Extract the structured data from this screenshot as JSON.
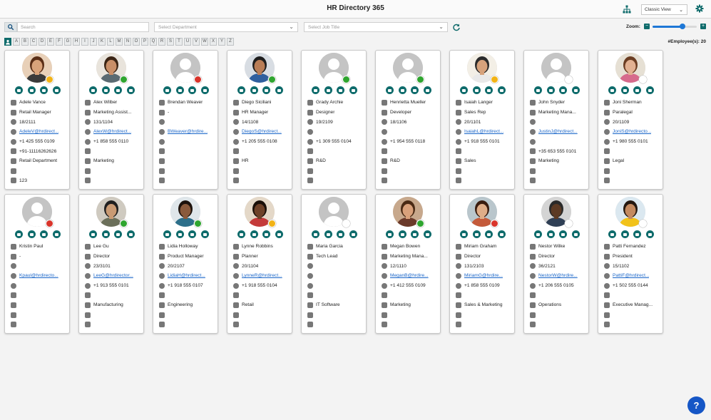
{
  "header": {
    "title": "HR Directory 365",
    "view": "Classic View"
  },
  "toolbar": {
    "search_placeholder": "Search",
    "department_placeholder": "Select Department",
    "job_placeholder": "Select Job Title",
    "zoom_label": "Zoom:",
    "zoom_level": 0.68,
    "employee_count": "#Employee(s): 20"
  },
  "alphabet": [
    "A",
    "B",
    "C",
    "D",
    "E",
    "F",
    "G",
    "H",
    "I",
    "J",
    "K",
    "L",
    "M",
    "N",
    "O",
    "P",
    "Q",
    "R",
    "S",
    "T",
    "U",
    "V",
    "W",
    "X",
    "Y",
    "Z"
  ],
  "colors": {
    "accent": "#0e6b6b",
    "link": "#1a66c9",
    "available": "#2fa52f",
    "busy": "#d9342b",
    "away": "#f2b316",
    "offline": "#ffffff",
    "help": "#1556c6"
  },
  "employees": [
    {
      "name": "Adele Vance",
      "title": "Retail Manager",
      "office": "18/2111",
      "email": "AdeleV@hrdirect...",
      "phone": "+1 425 555 0109",
      "mobile": "+91-11116262626",
      "department": "Retail Department",
      "extra": "",
      "extra2": "123",
      "status": "away",
      "photo": true,
      "skin": "#d9a37a",
      "hair": "#5a2e16",
      "shirt": "#3a3a3a",
      "bg": "#e8d0b8"
    },
    {
      "name": "Alex Wilber",
      "title": "Marketing Assist...",
      "office": "131/1104",
      "email": "AlexW@hrdirect...",
      "phone": "+1 858 555 0110",
      "mobile": "",
      "department": "Marketing",
      "extra": "",
      "extra2": "",
      "status": "available",
      "photo": true,
      "skin": "#c98f68",
      "hair": "#3b2414",
      "shirt": "#5a6a72",
      "bg": "#e9e4dc"
    },
    {
      "name": "Brendan Weaver",
      "title": "-",
      "office": "",
      "email": "BWeaver@hrdire...",
      "phone": "",
      "mobile": "",
      "department": "",
      "extra": "",
      "extra2": "",
      "status": "busy",
      "photo": false
    },
    {
      "name": "Diego Siciliani",
      "title": "HR Manager",
      "office": "14/1108",
      "email": "DiegoS@hrdirect...",
      "phone": "+1 205 555 0108",
      "mobile": "",
      "department": "HR",
      "extra": "",
      "extra2": "",
      "status": "available",
      "photo": true,
      "skin": "#b97d56",
      "hair": "#1e1e1e",
      "shirt": "#2f5f9e",
      "bg": "#d8dde3"
    },
    {
      "name": "Grady Archie",
      "title": "Designer",
      "office": "19/2109",
      "email": "",
      "phone": "+1 309 555 0104",
      "mobile": "",
      "department": "R&D",
      "extra": "",
      "extra2": "",
      "status": "available",
      "photo": false
    },
    {
      "name": "Henrietta Mueller",
      "title": "Developer",
      "office": "18/1106",
      "email": "",
      "phone": "+1 954 555 0118",
      "mobile": "",
      "department": "R&D",
      "extra": "",
      "extra2": "",
      "status": "available",
      "photo": false
    },
    {
      "name": "Isaiah Langer",
      "title": "Sales Rep",
      "office": "20/1101",
      "email": "IsaiahL@hrdirect...",
      "phone": "+1 918 555 0101",
      "mobile": "",
      "department": "Sales",
      "extra": "",
      "extra2": "",
      "status": "away",
      "photo": true,
      "skin": "#d6a27c",
      "hair": "#2b2b2b",
      "shirt": "#e9e9e9",
      "bg": "#f3efe6"
    },
    {
      "name": "John Snyder",
      "title": "Marketing Mana...",
      "office": "",
      "email": "JustinJ@hrdirect...",
      "phone": "",
      "mobile": "+35 653 555 0101",
      "department": "Marketing",
      "extra": "",
      "extra2": "",
      "status": "offline",
      "photo": false
    },
    {
      "name": "Joni Sherman",
      "title": "Paralegal",
      "office": "20/1109",
      "email": "JoniS@hrdirecto...",
      "phone": "+1 980 555 0101",
      "mobile": "",
      "department": "Legal",
      "extra": "",
      "extra2": "",
      "status": "offline",
      "photo": true,
      "skin": "#e2b192",
      "hair": "#6b3d22",
      "shirt": "#d66a8c",
      "bg": "#e6e0d4"
    },
    {
      "name": "Kristin Paul",
      "title": "-",
      "office": "",
      "email": "Kpaul@hrdirecto...",
      "phone": "",
      "mobile": "",
      "department": "",
      "extra": "",
      "extra2": "",
      "status": "busy",
      "photo": false
    },
    {
      "name": "Lee Gu",
      "title": "Director",
      "office": "23/3101",
      "email": "LeeG@hrdirector...",
      "phone": "+1 913 555 0101",
      "mobile": "",
      "department": "Manufacturing",
      "extra": "",
      "extra2": "",
      "status": "available",
      "photo": true,
      "skin": "#c99a73",
      "hair": "#1f1f1f",
      "shirt": "#6b6f5a",
      "bg": "#cfcac0"
    },
    {
      "name": "Lidia Holloway",
      "title": "Product Manager",
      "office": "20/2107",
      "email": "LidiaH@hrdirect...",
      "phone": "+1 918 555 0107",
      "mobile": "",
      "department": "Engineering",
      "extra": "",
      "extra2": "",
      "status": "available",
      "photo": true,
      "skin": "#8a5a3c",
      "hair": "#1c120c",
      "shirt": "#2c6f8a",
      "bg": "#dfe6ea"
    },
    {
      "name": "Lynne Robbins",
      "title": "Planner",
      "office": "20/1104",
      "email": "LynneR@hrdirect...",
      "phone": "+1 918 555 0104",
      "mobile": "",
      "department": "Retail",
      "extra": "",
      "extra2": "",
      "status": "away",
      "photo": true,
      "skin": "#6e4128",
      "hair": "#1a0f08",
      "shirt": "#c43a3a",
      "bg": "#e4d8c8"
    },
    {
      "name": "Maria Garcia",
      "title": "Tech Lead",
      "office": "",
      "email": "",
      "phone": "",
      "mobile": "",
      "department": "IT Software",
      "extra": "",
      "extra2": "",
      "status": "offline",
      "photo": false
    },
    {
      "name": "Megan Bowen",
      "title": "Marketing Mana...",
      "office": "12/1110",
      "email": "MeganB@hrdire...",
      "phone": "+1 412 555 0109",
      "mobile": "",
      "department": "Marketing",
      "extra": "",
      "extra2": "",
      "status": "available",
      "photo": true,
      "skin": "#d9a17b",
      "hair": "#4a2a14",
      "shirt": "#6b3a2a",
      "bg": "#c7a88c"
    },
    {
      "name": "Miriam Graham",
      "title": "Director",
      "office": "131/2103",
      "email": "MiriamG@hrdire...",
      "phone": "+1 858 555 0109",
      "mobile": "",
      "department": "Sales & Marketing",
      "extra": "",
      "extra2": "",
      "status": "busy",
      "photo": true,
      "skin": "#e0ad88",
      "hair": "#3a1c0f",
      "shirt": "#c45a3a",
      "bg": "#b9c6cc"
    },
    {
      "name": "Nestor Wilke",
      "title": "Director",
      "office": "36/2121",
      "email": "NestorW@hrdire...",
      "phone": "+1 206 555 0105",
      "mobile": "",
      "department": "Operations",
      "extra": "",
      "extra2": "",
      "status": "offline",
      "photo": true,
      "skin": "#5c3a24",
      "hair": "#2a2a2a",
      "shirt": "#2f3f55",
      "bg": "#d4d4d4"
    },
    {
      "name": "Patti Fernandez",
      "title": "President",
      "office": "15/1102",
      "email": "PattiF@hrdirect...",
      "phone": "+1 502 555 0144",
      "mobile": "",
      "department": "Executive Manag...",
      "extra": "",
      "extra2": "",
      "status": "offline",
      "photo": true,
      "skin": "#c48a60",
      "hair": "#241810",
      "shirt": "#f2c21a",
      "bg": "#dbe8f0"
    }
  ]
}
